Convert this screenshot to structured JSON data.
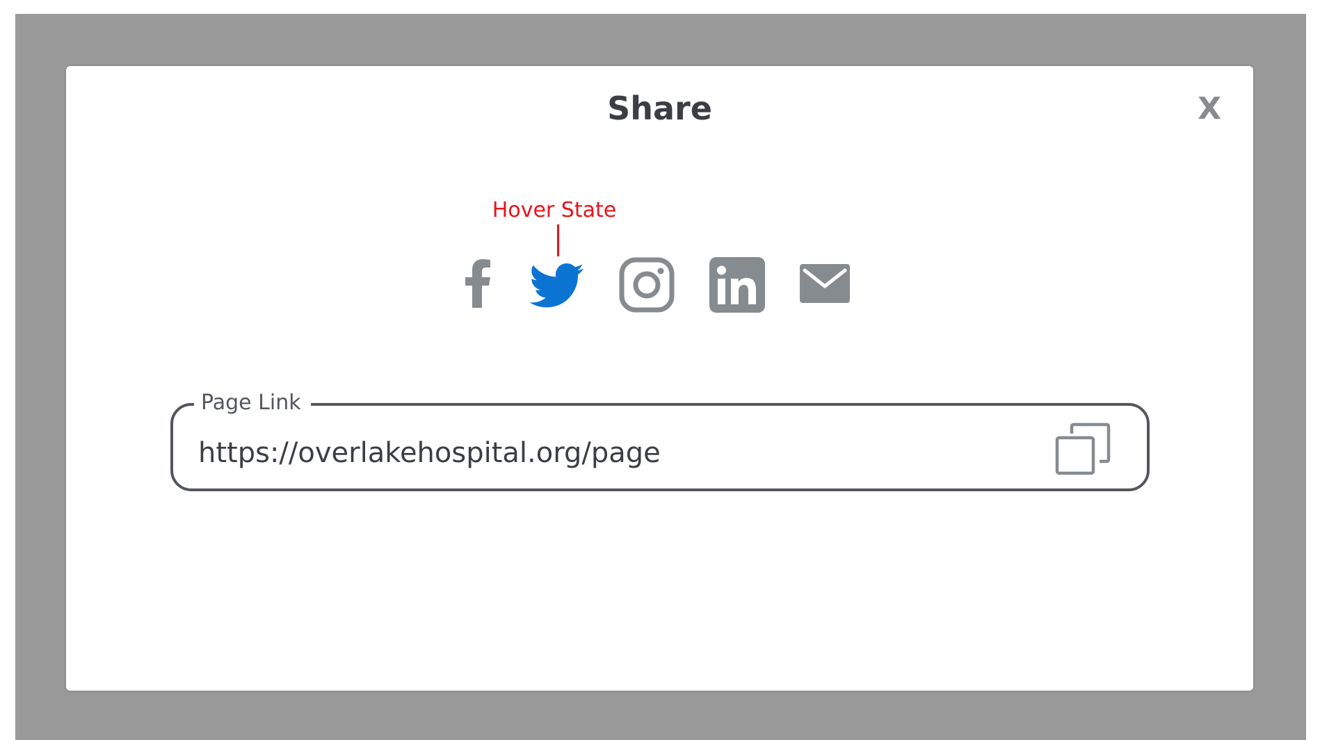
{
  "modal": {
    "title": "Share",
    "close_label": "X"
  },
  "annotation": {
    "label": "Hover State"
  },
  "share_icons": [
    {
      "name": "facebook-icon",
      "color": "#868b8f"
    },
    {
      "name": "twitter-icon",
      "color": "#0b74d3",
      "state": "hover"
    },
    {
      "name": "instagram-icon",
      "color": "#868b8f"
    },
    {
      "name": "linkedin-icon",
      "color": "#868b8f"
    },
    {
      "name": "email-icon",
      "color": "#868b8f"
    }
  ],
  "link_field": {
    "label": "Page Link",
    "value": "https://overlakehospital.org/page",
    "copy_icon": "copy-icon"
  },
  "colors": {
    "overlay": "#999999",
    "title": "#3b3e42",
    "icon_default": "#868b8f",
    "icon_hover": "#0b74d3",
    "annotation": "#e8141b",
    "field_border": "#53575c"
  }
}
